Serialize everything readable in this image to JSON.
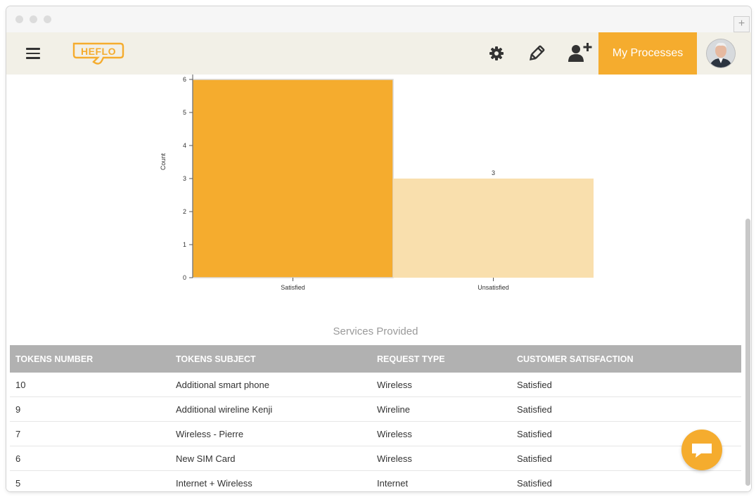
{
  "header": {
    "logo_text": "HEFLO",
    "my_processes": "My Processes",
    "icons": [
      "settings-icon",
      "edit-icon",
      "add-user-icon"
    ]
  },
  "colors": {
    "accent": "#f5ac2e",
    "accent_light": "#f9dfad",
    "header_bg": "#f2f0e7",
    "table_header_bg": "#b1b1b1"
  },
  "chart_data": {
    "type": "bar",
    "categories": [
      "Satisfied",
      "Unsatisfied"
    ],
    "values": [
      6,
      3
    ],
    "data_labels": [
      "",
      "3"
    ],
    "ylabel": "Count",
    "xlabel": "",
    "ylim": [
      0,
      6
    ],
    "yticks": [
      "0",
      "1",
      "2",
      "3",
      "4",
      "5",
      "6"
    ],
    "grid": false
  },
  "table": {
    "title": "Services Provided",
    "columns": [
      "TOKENS NUMBER",
      "TOKENS SUBJECT",
      "REQUEST TYPE",
      "CUSTOMER SATISFACTION"
    ],
    "rows": [
      [
        "10",
        "Additional smart phone",
        "Wireless",
        "Satisfied"
      ],
      [
        "9",
        "Additional wireline Kenji",
        "Wireline",
        "Satisfied"
      ],
      [
        "7",
        "Wireless - Pierre",
        "Wireless",
        "Satisfied"
      ],
      [
        "6",
        "New SIM Card",
        "Wireless",
        "Satisfied"
      ],
      [
        "5",
        "Internet + Wireless",
        "Internet",
        "Satisfied"
      ]
    ]
  }
}
